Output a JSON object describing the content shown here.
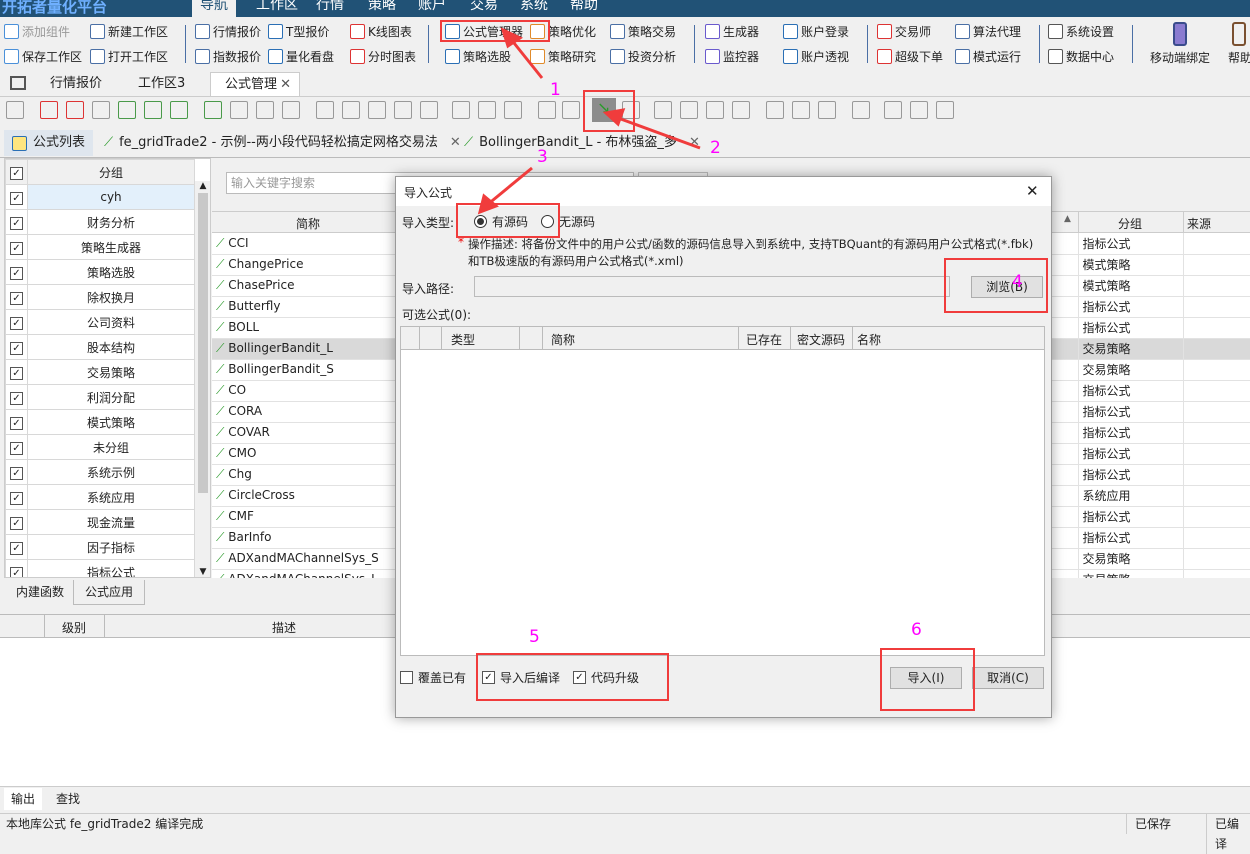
{
  "app": {
    "title": "开拓者量化平台",
    "menus": [
      "导航",
      "工作区",
      "行情",
      "策略",
      "账户",
      "交易",
      "系统",
      "帮助"
    ]
  },
  "ribbon": {
    "row1": [
      "添加组件",
      "新建工作区",
      "行情报价",
      "T型报价",
      "K线图表",
      "公式管理器",
      "策略优化",
      "策略交易",
      "生成器",
      "账户登录",
      "交易师",
      "算法代理",
      "系统设置"
    ],
    "row2": [
      "保存工作区",
      "打开工作区",
      "指数报价",
      "量化看盘",
      "分时图表",
      "策略选股",
      "策略研究",
      "投资分析",
      "监控器",
      "账户透视",
      "超级下单",
      "模式运行",
      "数据中心"
    ],
    "mobile": "移动端绑定",
    "help": "帮助"
  },
  "workspace_tabs": [
    "行情报价",
    "工作区3",
    "公式管理"
  ],
  "doc_tabs": [
    "公式列表",
    "fe_gridTrade2 - 示例--两小段代码轻松搞定网格交易法",
    "BollingerBandit_L - 布林强盗_多"
  ],
  "groups": {
    "header": "分组",
    "items": [
      "cyh",
      "财务分析",
      "策略生成器",
      "策略选股",
      "除权换月",
      "公司资料",
      "股本结构",
      "交易策略",
      "利润分配",
      "模式策略",
      "未分组",
      "系统示例",
      "系统应用",
      "现金流量",
      "因子指标",
      "指标公式"
    ]
  },
  "formula_list": {
    "search_placeholder": "输入关键字搜索",
    "col_name": "简称",
    "col_group": "分组",
    "col_source": "来源",
    "rows": [
      [
        "CCI",
        "指标公式"
      ],
      [
        "ChangePrice",
        "模式策略"
      ],
      [
        "ChasePrice",
        "模式策略"
      ],
      [
        "Butterfly",
        "指标公式"
      ],
      [
        "BOLL",
        "指标公式"
      ],
      [
        "BollingerBandit_L",
        "交易策略"
      ],
      [
        "BollingerBandit_S",
        "交易策略"
      ],
      [
        "CO",
        "指标公式"
      ],
      [
        "CORA",
        "指标公式"
      ],
      [
        "COVAR",
        "指标公式"
      ],
      [
        "CMO",
        "指标公式"
      ],
      [
        "Chg",
        "指标公式"
      ],
      [
        "CircleCross",
        "系统应用"
      ],
      [
        "CMF",
        "指标公式"
      ],
      [
        "BarInfo",
        "指标公式"
      ],
      [
        "ADXandMAChannelSys_S",
        "交易策略"
      ],
      [
        "ADXandMAChannelSys_L",
        "交易策略"
      ]
    ]
  },
  "bottom_tabs": [
    "内建函数",
    "公式应用"
  ],
  "bottom_table": {
    "cols": [
      "级别",
      "描述"
    ]
  },
  "output_tabs": [
    "输出",
    "查找"
  ],
  "status": {
    "message": "本地库公式 fe_gridTrade2 编译完成",
    "saved": "已保存",
    "compiled": "已编译"
  },
  "dialog": {
    "title": "导入公式",
    "type_label": "导入类型:",
    "opt_source": "有源码",
    "opt_nosource": "无源码",
    "selected": "有源码",
    "desc_star": "*",
    "desc": "操作描述: 将备份文件中的用户公式/函数的源码信息导入到系统中, 支持TBQuant的有源码用户公式格式(*.fbk)和TB极速版的有源码用户公式格式(*.xml)",
    "path_label": "导入路径:",
    "path_value": "",
    "browse": "浏览(B)",
    "available": "可选公式(0):",
    "cols": [
      "类型",
      "简称",
      "已存在",
      "密文源码",
      "名称"
    ],
    "overwrite": "覆盖已有",
    "overwrite_checked": false,
    "compile_after": "导入后编译",
    "compile_checked": true,
    "upgrade": "代码升级",
    "upgrade_checked": true,
    "import": "导入(I)",
    "cancel": "取消(C)"
  },
  "annotations": [
    "1",
    "2",
    "3",
    "4",
    "5",
    "6"
  ],
  "colors": {
    "titlebar": "#215276",
    "annotation_box": "#f03c3c",
    "annotation_number": "#ff00ff"
  }
}
